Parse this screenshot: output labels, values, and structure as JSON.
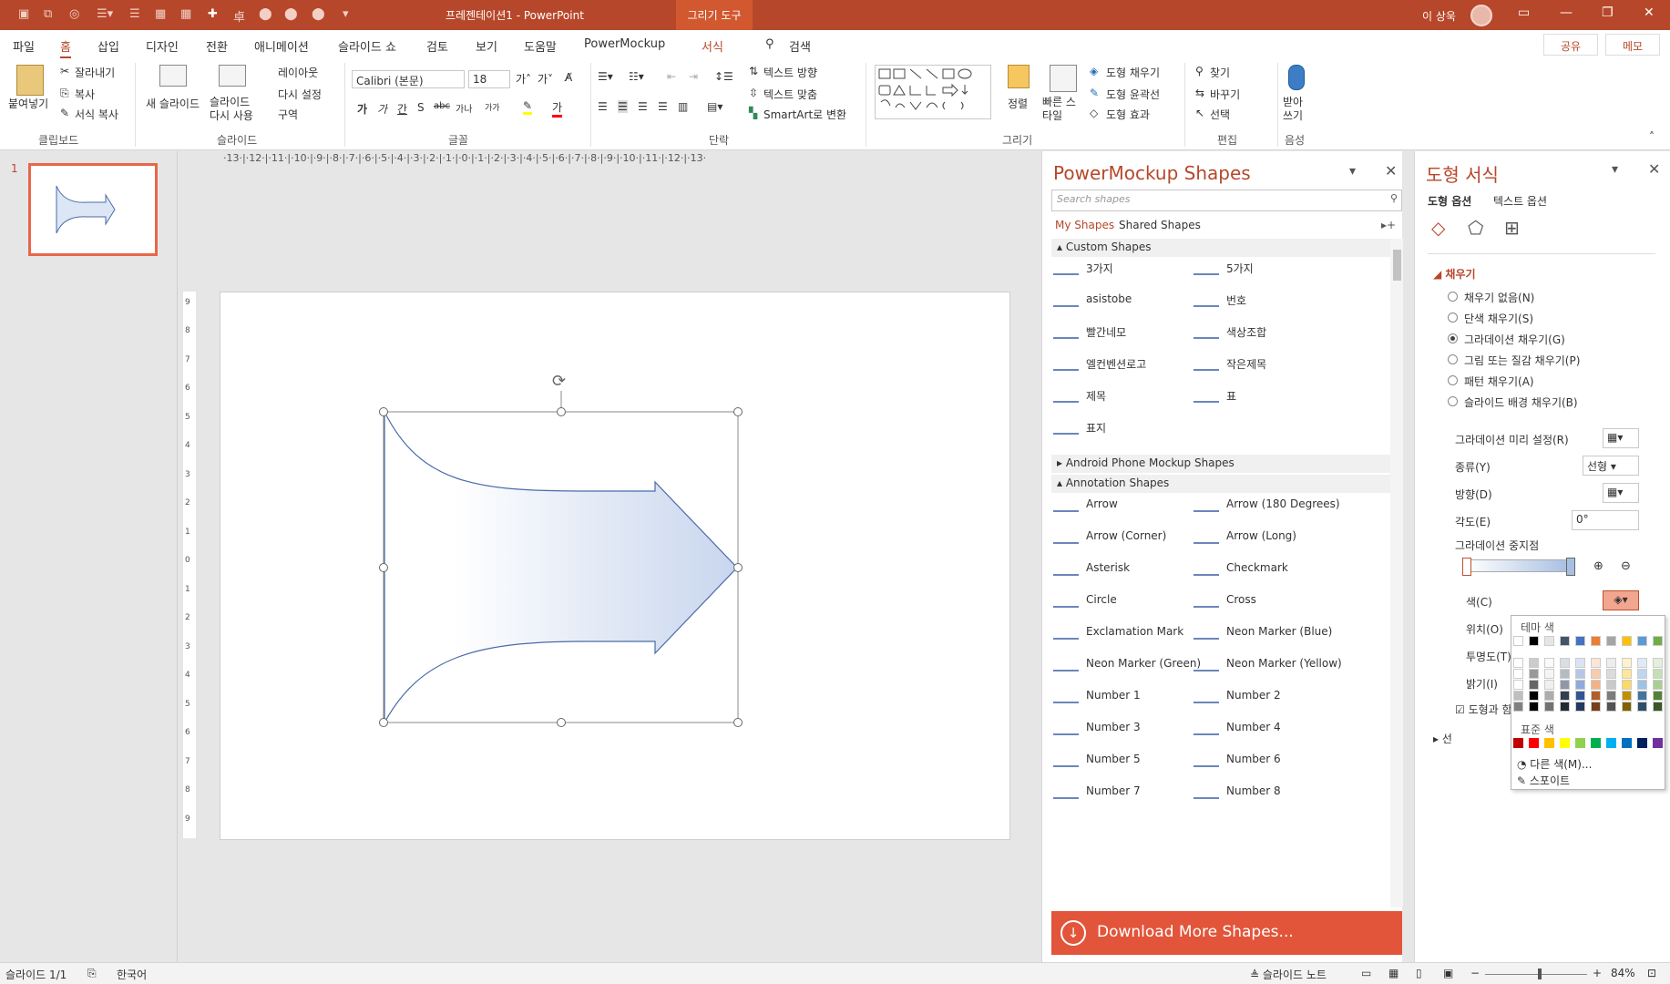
{
  "titlebar": {
    "title": "프레젠테이션1  -  PowerPoint",
    "context_tab": "그리기 도구",
    "user": "이 상욱",
    "accent": "#b7472a"
  },
  "menu": {
    "items": [
      "파일",
      "홈",
      "삽입",
      "디자인",
      "전환",
      "애니메이션",
      "슬라이드 쇼",
      "검토",
      "보기",
      "도움말",
      "PowerMockup",
      "서식"
    ],
    "active": "홈",
    "search": "검색",
    "share": "공유",
    "memo": "메모"
  },
  "ribbon": {
    "clipboard": {
      "paste": "붙여넣기",
      "cut": "잘라내기",
      "copy": "복사",
      "format_copy": "서식 복사",
      "label": "클립보드"
    },
    "slides": {
      "new": "새 슬라이드",
      "reuse": "슬라이드 다시 사용",
      "layout": "레이아웃",
      "reset": "다시 설정",
      "section": "구역",
      "label": "슬라이드"
    },
    "font": {
      "name": "Calibri (본문)",
      "size": "18",
      "label": "글꼴",
      "styles": [
        "가",
        "가",
        "간",
        "S",
        "abc",
        "가나",
        "가가"
      ]
    },
    "paragraph": {
      "text_dir": "텍스트 방향",
      "align_text": "텍스트 맞춤",
      "smartart": "SmartArt로 변환",
      "label": "단락"
    },
    "drawing": {
      "arrange": "정렬",
      "quick": "빠른 스타일",
      "fill": "도형 채우기",
      "outline": "도형 윤곽선",
      "effects": "도형 효과",
      "label": "그리기"
    },
    "editing": {
      "find": "찾기",
      "replace": "바꾸기",
      "select": "선택",
      "label": "편집"
    },
    "voice": {
      "dictate": "받아쓰기",
      "label": "음성"
    }
  },
  "slides": {
    "number": "1"
  },
  "ruler": {
    "h": "·13·|·12·|·11·|·10·|·9·|·8·|·7·|·6·|·5·|·4·|·3·|·2·|·1·|·0·|·1·|·2·|·3·|·4·|·5·|·6·|·7·|·8·|·9·|·10·|·11·|·12·|·13·"
  },
  "mockup": {
    "title": "PowerMockup Shapes",
    "search_placeholder": "Search shapes",
    "tab_my": "My Shapes",
    "tab_shared": "Shared Shapes",
    "groups": {
      "custom": "Custom Shapes",
      "android": "Android Phone Mockup Shapes",
      "annotation": "Annotation Shapes"
    },
    "custom_items": [
      "3가지",
      "5가지",
      "asistobe",
      "번호",
      "빨간네모",
      "색상조합",
      "엘컨벤션로고",
      "작은제목",
      "제목",
      "표",
      "표지"
    ],
    "annotation_items": [
      "Arrow",
      "Arrow (180 Degrees)",
      "Arrow (Corner)",
      "Arrow (Long)",
      "Asterisk",
      "Checkmark",
      "Circle",
      "Cross",
      "Exclamation Mark",
      "Neon Marker (Blue)",
      "Neon Marker (Green)",
      "Neon Marker (Yellow)",
      "Number 1",
      "Number 2",
      "Number 3",
      "Number 4",
      "Number 5",
      "Number 6",
      "Number 7",
      "Number 8"
    ],
    "download": "Download More Shapes..."
  },
  "format": {
    "title": "도형 서식",
    "tab_shape": "도형 옵션",
    "tab_text": "텍스트 옵션",
    "section_fill": "채우기",
    "section_line": "선",
    "fill_options": [
      "채우기 없음(N)",
      "단색 채우기(S)",
      "그라데이션 채우기(G)",
      "그림 또는 질감 채우기(P)",
      "패턴 채우기(A)",
      "슬라이드 배경 채우기(B)"
    ],
    "selected_fill": 2,
    "preset": "그라데이션 미리 설정(R)",
    "type": "종류(Y)",
    "type_val": "선형",
    "direction": "방향(D)",
    "angle": "각도(E)",
    "angle_val": "0°",
    "stops": "그라데이션 중지점",
    "color": "색(C)",
    "position": "위치(O)",
    "transparency": "투명도(T)",
    "brightness": "밝기(I)",
    "rotate_with": "도형과 함께"
  },
  "color_popup": {
    "theme": "테마 색",
    "standard": "표준 색",
    "more": "다른 색(M)...",
    "eyedropper": "스포이트",
    "theme_top": [
      "#ffffff",
      "#000000",
      "#e7e6e6",
      "#44546a",
      "#4472c4",
      "#ed7d31",
      "#a5a5a5",
      "#ffc000",
      "#5b9bd5",
      "#70ad47"
    ],
    "standard_colors": [
      "#c00000",
      "#ff0000",
      "#ffc000",
      "#ffff00",
      "#92d050",
      "#00b050",
      "#00b0f0",
      "#0070c0",
      "#002060",
      "#7030a0"
    ]
  },
  "status": {
    "slide": "슬라이드 1/1",
    "lang": "한국어",
    "notes": "슬라이드 노트",
    "zoom": "84%"
  }
}
